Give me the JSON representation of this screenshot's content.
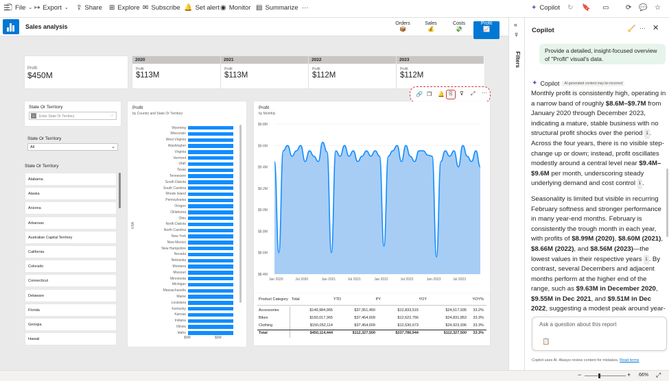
{
  "toolbar": {
    "file": "File",
    "export": "Export",
    "share": "Share",
    "explore": "Explore",
    "subscribe": "Subscribe",
    "set_alert": "Set alert",
    "monitor": "Monitor",
    "summarize": "Summarize",
    "more": "···",
    "copilot": "Copilot"
  },
  "report": {
    "title": "Sales analysis",
    "tabs": [
      {
        "label": "Orders",
        "icon": "📦"
      },
      {
        "label": "Sales",
        "icon": "💰"
      },
      {
        "label": "Costs",
        "icon": "💸"
      },
      {
        "label": "Profit",
        "icon": "📈"
      }
    ]
  },
  "kpi": {
    "label": "Profit",
    "value": "$450M"
  },
  "years": [
    {
      "year": "2020",
      "label": "Profit",
      "value": "$113M"
    },
    {
      "year": "2021",
      "label": "Profit",
      "value": "$113M"
    },
    {
      "year": "2022",
      "label": "Profit",
      "value": "$112M"
    },
    {
      "year": "2023",
      "label": "Profit",
      "value": "$112M"
    }
  ],
  "slicer1": {
    "title": "State Or Territory",
    "placeholder": "Enter State Or Territory"
  },
  "slicer2": {
    "title": "State Or Territory",
    "value": "All"
  },
  "slicer3": {
    "title": "State Or Territory",
    "items": [
      "Alabama",
      "Alaska",
      "Arizona",
      "Arkansas",
      "Australian Capital Territory",
      "California",
      "Colorado",
      "Connecticut",
      "Delaware",
      "Florida",
      "Georgia",
      "Hawaii"
    ]
  },
  "bar_chart": {
    "title": "Profit",
    "subtitle": "by Country and State Or Territory",
    "ylabel": "USA",
    "ticks": [
      "$0M",
      "$5M"
    ]
  },
  "chart_data": [
    {
      "type": "bar",
      "title": "Profit",
      "subtitle": "by Country and State Or Territory",
      "ylabel": "USA",
      "categories": [
        "Wyoming",
        "Wisconsin",
        "West Virginia",
        "Washington",
        "Virginia",
        "Vermont",
        "Utah",
        "Texas",
        "Tennessee",
        "South Dakota",
        "South Carolina",
        "Rhode Island",
        "Pennsylvania",
        "Oregon",
        "Oklahoma",
        "Ohio",
        "North Dakota",
        "North Carolina",
        "New York",
        "New Mexico",
        "New Hampshire",
        "Nevada",
        "Nebraska",
        "Montana",
        "Missouri",
        "Minnesota",
        "Michigan",
        "Massachusetts",
        "Maine",
        "Louisiana",
        "Kentucky",
        "Kansas",
        "Indiana",
        "Illinois",
        "Idaho"
      ],
      "values": [
        7.5,
        7.5,
        7.5,
        7.5,
        7.5,
        7.5,
        7.5,
        7.5,
        7.5,
        7.5,
        7.5,
        7.5,
        7.5,
        7.5,
        7.5,
        7.5,
        7.5,
        7.5,
        7.5,
        7.5,
        7.5,
        7.5,
        7.5,
        7.5,
        7.5,
        7.5,
        7.5,
        7.5,
        7.5,
        7.5,
        7.5,
        7.5,
        7.5,
        7.5,
        7.5
      ],
      "ticks": [
        "$0M",
        "$5M"
      ]
    },
    {
      "type": "area",
      "title": "Profit",
      "subtitle": "by Monthly",
      "ylim": [
        8.4,
        9.8
      ],
      "yticks": [
        "$9.8M",
        "$9.6M",
        "$9.4M",
        "$9.2M",
        "$9.0M",
        "$8.8M",
        "$8.6M",
        "$8.4M"
      ],
      "xticks": [
        "Jan 2020",
        "Jul 2020",
        "Jan 2021",
        "Jul 2021",
        "Jan 2022",
        "Jul 2022",
        "Jan 2023",
        "Jul 2023"
      ],
      "values": [
        9.45,
        8.6,
        9.55,
        9.6,
        9.5,
        9.55,
        9.6,
        9.45,
        9.55,
        9.5,
        9.45,
        9.63,
        9.54,
        8.6,
        9.55,
        9.5,
        9.6,
        9.5,
        9.55,
        9.45,
        9.5,
        9.55,
        9.5,
        9.55,
        9.5,
        8.66,
        9.5,
        9.55,
        9.6,
        9.45,
        9.6,
        9.5,
        9.45,
        9.55,
        9.55,
        9.51,
        9.5,
        8.56,
        9.45,
        9.55,
        9.5,
        9.55,
        9.4,
        9.6,
        9.5,
        9.45,
        9.55,
        9.4
      ]
    }
  ],
  "area_chart": {
    "title": "Profit",
    "subtitle": "by Monthly"
  },
  "table": {
    "headers": [
      "Product Category",
      "Total",
      "YTD",
      "PY",
      "YOY",
      "YOY%"
    ],
    "rows": [
      [
        "Accessories",
        "$149,984,965",
        "$37,351,450",
        "$12,833,515",
        "$24,517,935",
        "33.2%"
      ],
      [
        "Bikes",
        "$150,017,365",
        "$37,454,609",
        "$12,622,756",
        "$24,831,853",
        "33.3%"
      ],
      [
        "Clothing",
        "$150,052,114",
        "$37,454,609",
        "$12,530,673",
        "$24,923,936",
        "33.3%"
      ],
      [
        "Total",
        "$450,114,444",
        "$112,327,500",
        "$337,786,944",
        "$112,327,500",
        "33.3%"
      ]
    ]
  },
  "filters": {
    "label": "Filters"
  },
  "copilot": {
    "title": "Copilot",
    "prompt": "Provide a detailed, insight-focused overview of \"Profit\" visual's data.",
    "name": "Copilot",
    "disclaimer": "AI-generated content may be incorrect",
    "ask_placeholder": "Ask a question about this report",
    "footer": "Copilot uses AI. Always review content for mistakes.",
    "read_terms": "Read terms"
  },
  "status": {
    "zoom": "66%"
  }
}
